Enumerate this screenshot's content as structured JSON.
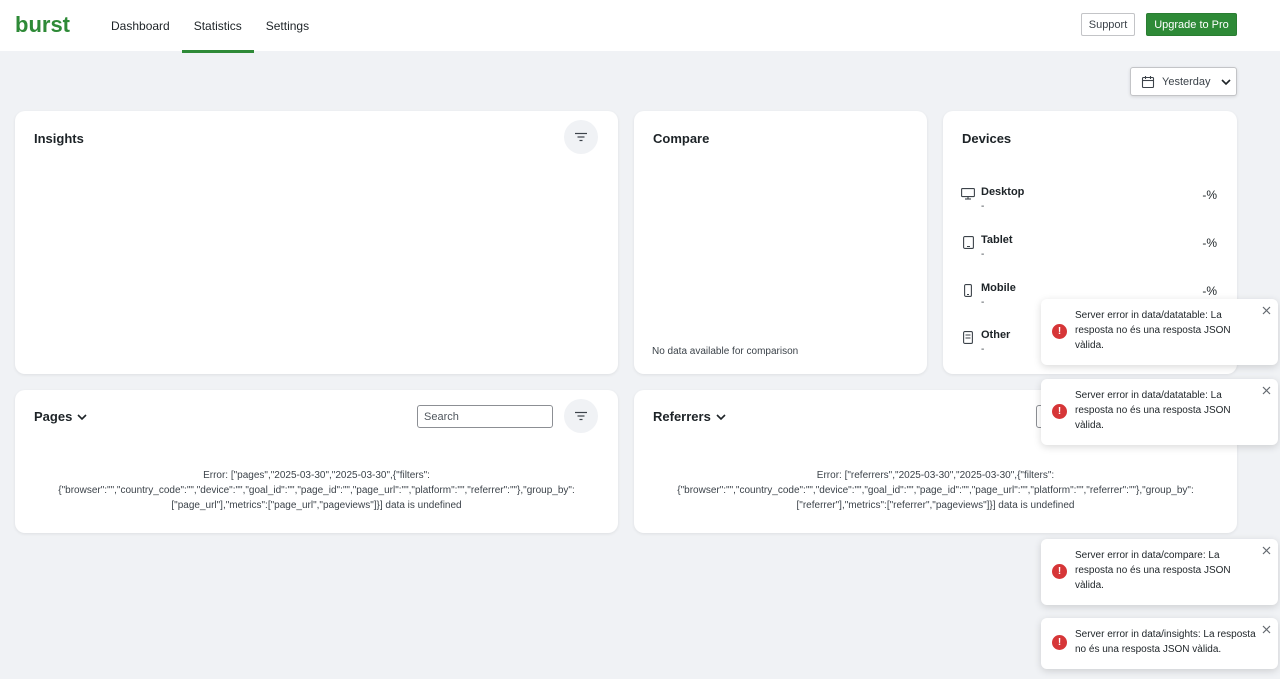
{
  "header": {
    "logo_text": "burst",
    "nav": [
      {
        "label": "Dashboard",
        "active": false
      },
      {
        "label": "Statistics",
        "active": true
      },
      {
        "label": "Settings",
        "active": false
      }
    ],
    "support_label": "Support",
    "upgrade_label": "Upgrade to Pro"
  },
  "date_picker": {
    "label": "Yesterday"
  },
  "insights": {
    "title": "Insights"
  },
  "compare": {
    "title": "Compare",
    "empty_text": "No data available for comparison"
  },
  "devices": {
    "title": "Devices",
    "items": [
      {
        "name": "Desktop",
        "sub": "-",
        "percent": "-%",
        "icon": "desktop-icon"
      },
      {
        "name": "Tablet",
        "sub": "-",
        "percent": "-%",
        "icon": "tablet-icon"
      },
      {
        "name": "Mobile",
        "sub": "-",
        "percent": "-%",
        "icon": "mobile-icon"
      },
      {
        "name": "Other",
        "sub": "-",
        "percent": "",
        "icon": "other-device-icon"
      }
    ]
  },
  "pages": {
    "title": "Pages",
    "search_placeholder": "Search",
    "error_text": "Error: [\"pages\",\"2025-03-30\",\"2025-03-30\",{\"filters\":{\"browser\":\"\",\"country_code\":\"\",\"device\":\"\",\"goal_id\":\"\",\"page_id\":\"\",\"page_url\":\"\",\"platform\":\"\",\"referrer\":\"\"},\"group_by\":[\"page_url\"],\"metrics\":[\"page_url\",\"pageviews\"]}] data is undefined"
  },
  "referrers": {
    "title": "Referrers",
    "error_text": "Error: [\"referrers\",\"2025-03-30\",\"2025-03-30\",{\"filters\":{\"browser\":\"\",\"country_code\":\"\",\"device\":\"\",\"goal_id\":\"\",\"page_id\":\"\",\"page_url\":\"\",\"platform\":\"\",\"referrer\":\"\"},\"group_by\":[\"referrer\"],\"metrics\":[\"referrer\",\"pageviews\"]}] data is undefined"
  },
  "toasts": [
    {
      "message": "Server error in data/datatable: La resposta no és una resposta JSON vàlida."
    },
    {
      "message": "Server error in data/datatable: La resposta no és una resposta JSON vàlida."
    },
    {
      "message": "Server error in data/compare: La resposta no és una resposta JSON vàlida."
    },
    {
      "message": "Server error in data/insights: La resposta no és una resposta JSON vàlida."
    }
  ],
  "colors": {
    "brand_green": "#2e8a37",
    "error_red": "#d63638",
    "background": "#f0f2f5"
  }
}
